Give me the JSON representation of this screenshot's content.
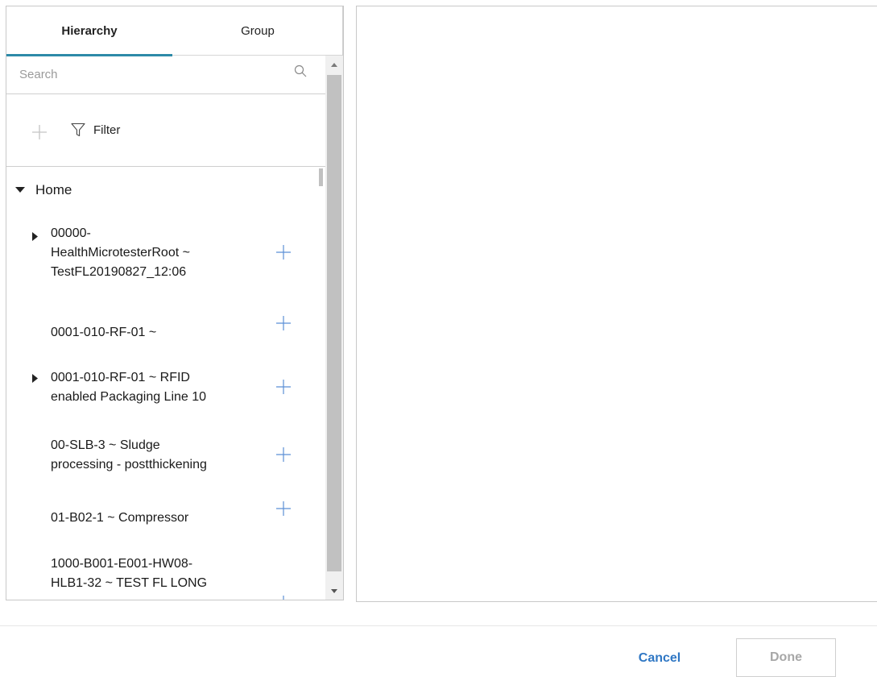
{
  "tabs": [
    {
      "label": "Hierarchy",
      "active": true
    },
    {
      "label": "Group",
      "active": false
    }
  ],
  "search": {
    "placeholder": "Search",
    "value": ""
  },
  "toolbar": {
    "filter_label": "Filter"
  },
  "tree": {
    "root_label": "Home",
    "items": [
      {
        "lines": [
          "00000-",
          "HealthMicrotesterRoot ~",
          "TestFL20190827_12:06"
        ],
        "expandable": true
      },
      {
        "lines": [
          "0001-010-RF-01 ~"
        ],
        "expandable": false
      },
      {
        "lines": [
          "0001-010-RF-01 ~ RFID",
          "enabled Packaging Line 10"
        ],
        "expandable": true
      },
      {
        "lines": [
          "00-SLB-3 ~ Sludge",
          "processing - postthickening"
        ],
        "expandable": false
      },
      {
        "lines": [
          "01-B02-1 ~ Compressor"
        ],
        "expandable": false
      },
      {
        "lines": [
          "1000-B001-E001-HW08-",
          "HLB1-32 ~ TEST FL LONG"
        ],
        "expandable": false
      }
    ]
  },
  "footer": {
    "cancel_label": "Cancel",
    "done_label": "Done"
  },
  "colors": {
    "accent": "#2d8aa8",
    "link": "#2f77c4",
    "add_icon": "#5b8fd6",
    "disabled_text": "#a7a7a7"
  },
  "icons": [
    "search-icon",
    "add-icon",
    "filter-icon",
    "caret-down-icon",
    "caret-right-icon",
    "scroll-up-icon",
    "scroll-down-icon"
  ]
}
